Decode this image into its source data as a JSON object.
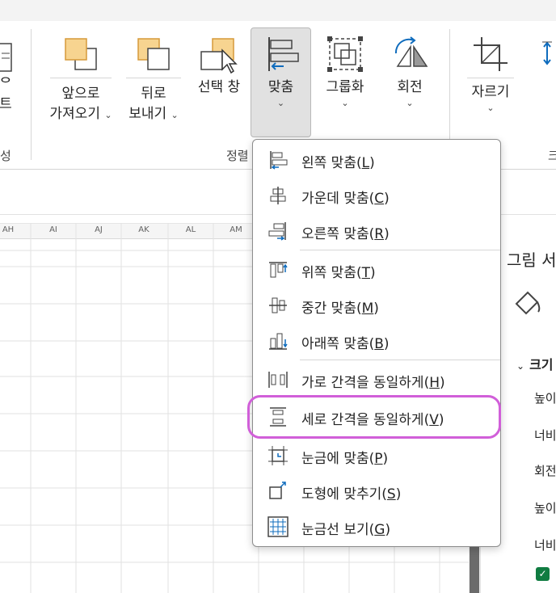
{
  "ribbon": {
    "left_cut": {
      "line1": "ᄋ",
      "line2": "트"
    },
    "bring_forward": {
      "line1": "앞으로",
      "line2": "가져오기"
    },
    "send_backward": {
      "line1": "뒤로",
      "line2": "보내기"
    },
    "selection_pane": {
      "label": "선택 창"
    },
    "align": {
      "label": "맞춤"
    },
    "group": {
      "label": "그룹화"
    },
    "rotate": {
      "label": "회전"
    },
    "crop": {
      "label": "자르기"
    },
    "group_labels": {
      "left": "성",
      "arrange": "정렬",
      "right": "크"
    }
  },
  "sheet": {
    "columns": [
      "AH",
      "AI",
      "AJ",
      "AK",
      "AL",
      "AM"
    ]
  },
  "pane": {
    "title": "그림 서",
    "section": "크기",
    "rows": [
      "높이",
      "너비",
      "회전",
      "높이",
      "너비"
    ]
  },
  "menu": {
    "items": [
      {
        "text": "왼쪽 맞춤(",
        "key": "L",
        "end": ")"
      },
      {
        "text": "가운데 맞춤(",
        "key": "C",
        "end": ")"
      },
      {
        "text": "오른쪽 맞춤(",
        "key": "R",
        "end": ")"
      },
      {
        "text": "위쪽 맞춤(",
        "key": "T",
        "end": ")"
      },
      {
        "text": "중간 맞춤(",
        "key": "M",
        "end": ")"
      },
      {
        "text": "아래쪽 맞춤(",
        "key": "B",
        "end": ")"
      },
      {
        "text": "가로 간격을 동일하게(",
        "key": "H",
        "end": ")"
      },
      {
        "text": "세로 간격을 동일하게(",
        "key": "V",
        "end": ")"
      },
      {
        "text": "눈금에 맞춤(",
        "key": "P",
        "end": ")"
      },
      {
        "text": "도형에 맞추기(",
        "key": "S",
        "end": ")"
      },
      {
        "text": "눈금선 보기(",
        "key": "G",
        "end": ")"
      }
    ]
  },
  "colors": {
    "accent_blue": "#0f6cbd",
    "shape_fill": "#f7d490",
    "shape_stroke": "#d69a3a",
    "highlight": "#d15fd9",
    "excel_green": "#107c41"
  }
}
